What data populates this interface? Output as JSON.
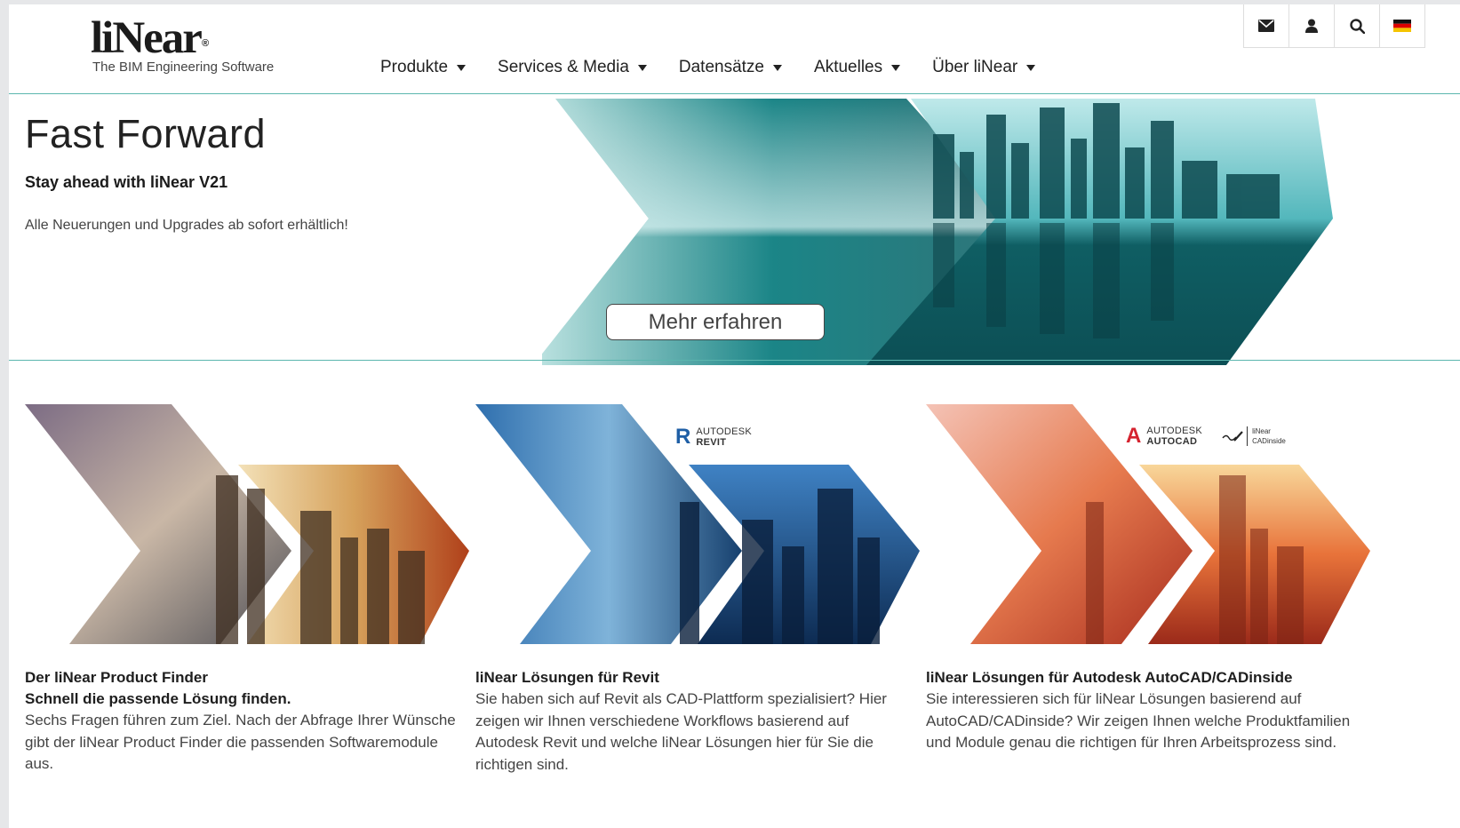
{
  "header": {
    "logo_word": "liNear",
    "logo_reg": "®",
    "logo_tagline": "The BIM Engineering Software",
    "nav": [
      {
        "label": "Produkte"
      },
      {
        "label": "Services & Media"
      },
      {
        "label": "Datensätze"
      },
      {
        "label": "Aktuelles"
      },
      {
        "label": "Über liNear"
      }
    ],
    "utility_icons": [
      "mail-icon",
      "user-icon",
      "search-icon",
      "german-flag-icon"
    ]
  },
  "hero": {
    "title": "Fast Forward",
    "subtitle": "Stay ahead with liNear V21",
    "text": "Alle Neuerungen und Upgrades ab sofort erhältlich!",
    "button_label": "Mehr erfahren"
  },
  "cards": [
    {
      "title": "Der liNear Product Finder",
      "subtitle": "Schnell die passende Lösung finden.",
      "body": "Sechs Fragen führen zum Ziel. Nach der Abfrage Ihrer Wünsche gibt der liNear Product Finder die passenden Softwaremodule aus."
    },
    {
      "title": "liNear Lösungen für Revit",
      "body": "Sie haben sich auf Revit als CAD-Plattform spezialisiert? Hier zeigen wir Ihnen verschiedene Workflows basierend auf Autodesk Revit und welche liNear Lösungen hier für Sie die richtigen sind.",
      "badge": {
        "letter": "R",
        "line1": "AUTODESK",
        "line2": "REVIT",
        "color": "#1f5fa6"
      }
    },
    {
      "title": "liNear Lösungen für Autodesk AutoCAD/CADinside",
      "body": "Sie interessieren sich für liNear Lösungen basierend auf AutoCAD/CADinside? Wir zeigen Ihnen welche Produktfamilien und Module genau die richtigen für Ihren Arbeitsprozess sind.",
      "badge": {
        "letter": "A",
        "line1": "AUTODESK",
        "line2": "AUTOCAD",
        "color": "#d5232f",
        "partner_line1": "liNear",
        "partner_line2": "CADinside"
      }
    }
  ],
  "colors": {
    "accent_line": "#5bb6ae",
    "teal": "#1d8a8c",
    "blue": "#1f4f8f",
    "orange": "#e2652a"
  }
}
